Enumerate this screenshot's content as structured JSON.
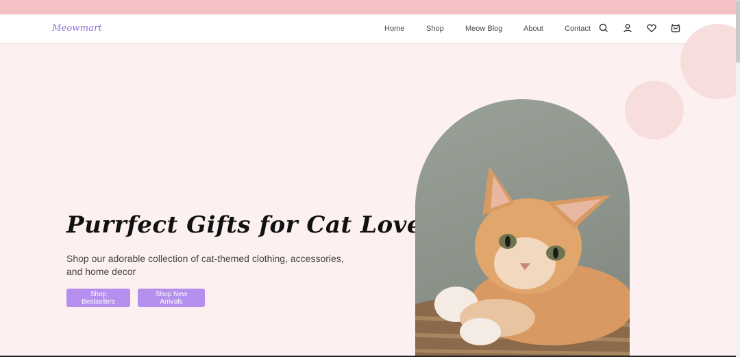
{
  "brand": {
    "logo": "Meowmart"
  },
  "nav": {
    "links": [
      {
        "label": "Home"
      },
      {
        "label": "Shop"
      },
      {
        "label": "Meow Blog"
      },
      {
        "label": "About"
      },
      {
        "label": "Contact"
      }
    ],
    "icons": [
      "search-icon",
      "user-icon",
      "heart-icon",
      "cart-icon"
    ]
  },
  "hero": {
    "title": "Purrfect Gifts for Cat Lovers",
    "subtitle": "Shop our adorable collection of cat-themed clothing, accessories, and home decor",
    "buttons": {
      "bestsellers": "Shop Bestsellers",
      "new_arrivals": "Shop New Arrivals"
    },
    "image_alt": "Orange tabby kitten lying on a woven basket"
  },
  "colors": {
    "banner": "#f4c2c4",
    "background": "#fdf0f0",
    "accent": "#b48fee",
    "logo": "#8d6fd8"
  }
}
